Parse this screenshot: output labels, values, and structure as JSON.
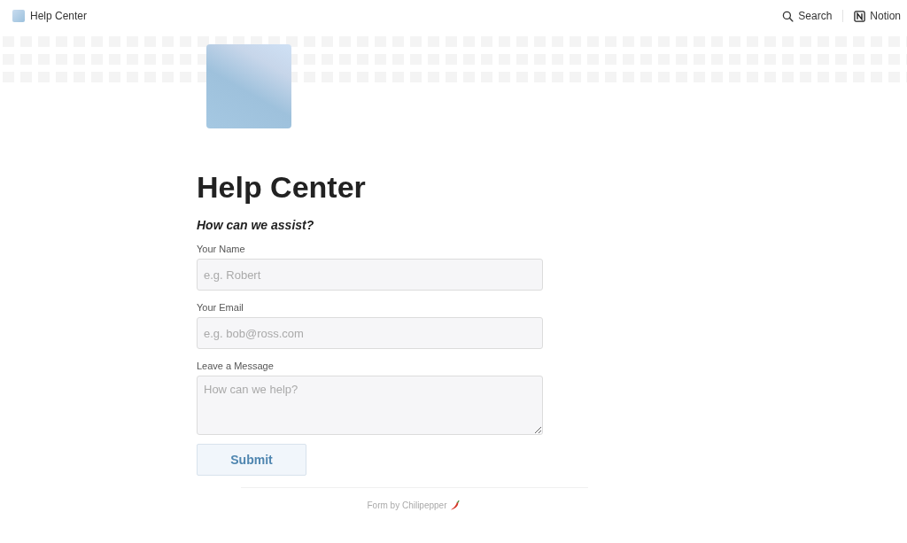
{
  "topbar": {
    "page_title": "Help Center",
    "search": "Search",
    "app": "Notion"
  },
  "title": "Help Center",
  "subtitle": "How can we assist?",
  "fields": [
    {
      "kind": "input",
      "label": "Your Name",
      "placeholder": "e.g. Robert"
    },
    {
      "kind": "input",
      "label": "Your Email",
      "placeholder": "e.g. bob@ross.com"
    },
    {
      "kind": "textarea",
      "label": "Leave a Message",
      "placeholder": "How can we help?"
    }
  ],
  "submit": "Submit",
  "footer": "Form by Chilipepper"
}
